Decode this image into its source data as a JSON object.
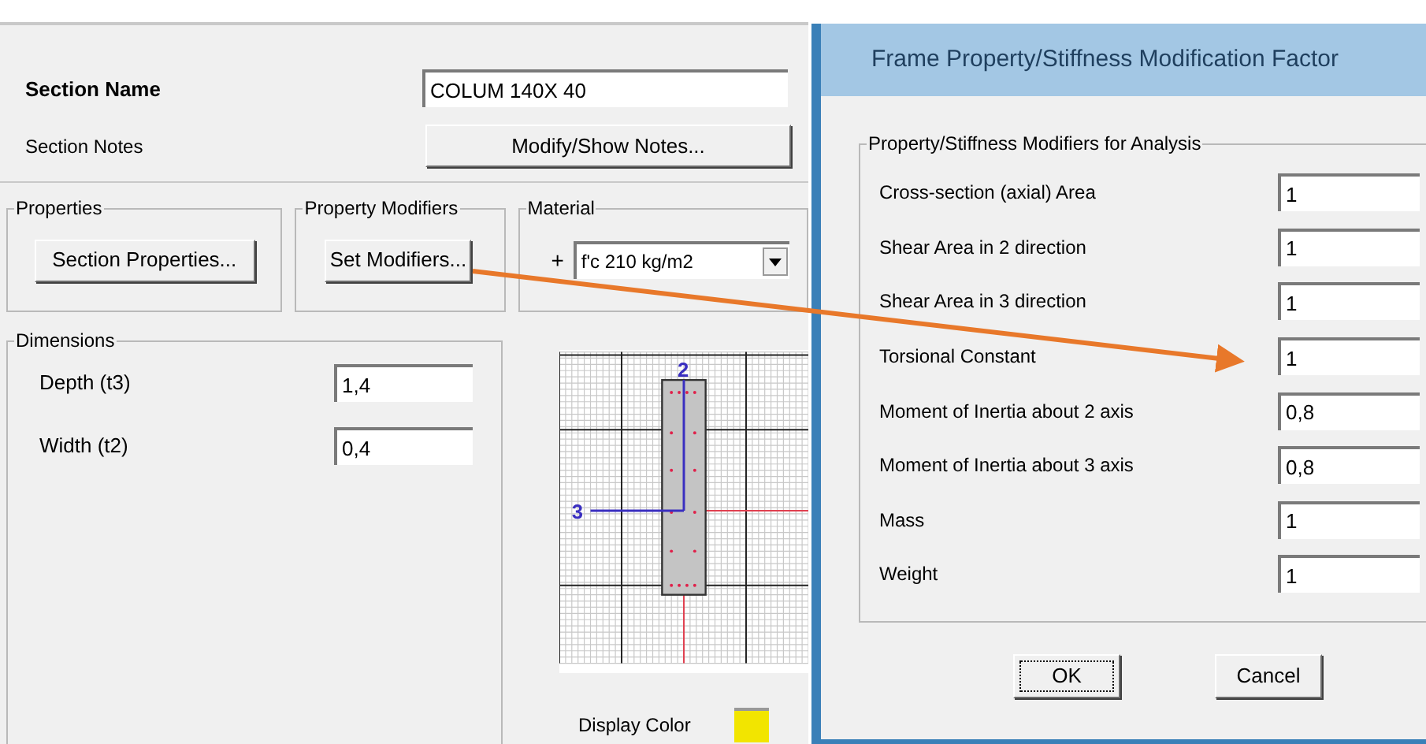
{
  "section_name": {
    "label": "Section Name",
    "value": "COLUM 140X 40"
  },
  "section_notes": {
    "label": "Section Notes",
    "button": "Modify/Show Notes..."
  },
  "properties": {
    "title": "Properties",
    "button": "Section Properties..."
  },
  "property_modifiers": {
    "title": "Property Modifiers",
    "button": "Set Modifiers..."
  },
  "material": {
    "title": "Material",
    "add_button": "+",
    "value": "f'c 210 kg/m2"
  },
  "dimensions": {
    "title": "Dimensions",
    "fields": [
      {
        "label": "Depth (t3)",
        "value": "1,4"
      },
      {
        "label": "Width (t2)",
        "value": "0,4"
      }
    ]
  },
  "section_preview": {
    "axis_labels": [
      "2",
      "3"
    ]
  },
  "display_color": {
    "label": "Display Color",
    "color": "#f2e500"
  },
  "dialog": {
    "title": "Frame Property/Stiffness Modification Factor",
    "group_title": "Property/Stiffness Modifiers for Analysis",
    "modifiers": [
      {
        "label": "Cross-section (axial) Area",
        "value": "1"
      },
      {
        "label": "Shear Area in 2 direction",
        "value": "1"
      },
      {
        "label": "Shear Area in 3 direction",
        "value": "1"
      },
      {
        "label": "Torsional Constant",
        "value": "1"
      },
      {
        "label": "Moment of Inertia about 2 axis",
        "value": "0,8"
      },
      {
        "label": "Moment of Inertia about 3 axis",
        "value": "0,8"
      },
      {
        "label": "Mass",
        "value": "1"
      },
      {
        "label": "Weight",
        "value": "1"
      }
    ],
    "buttons": [
      "OK",
      "Cancel"
    ]
  }
}
